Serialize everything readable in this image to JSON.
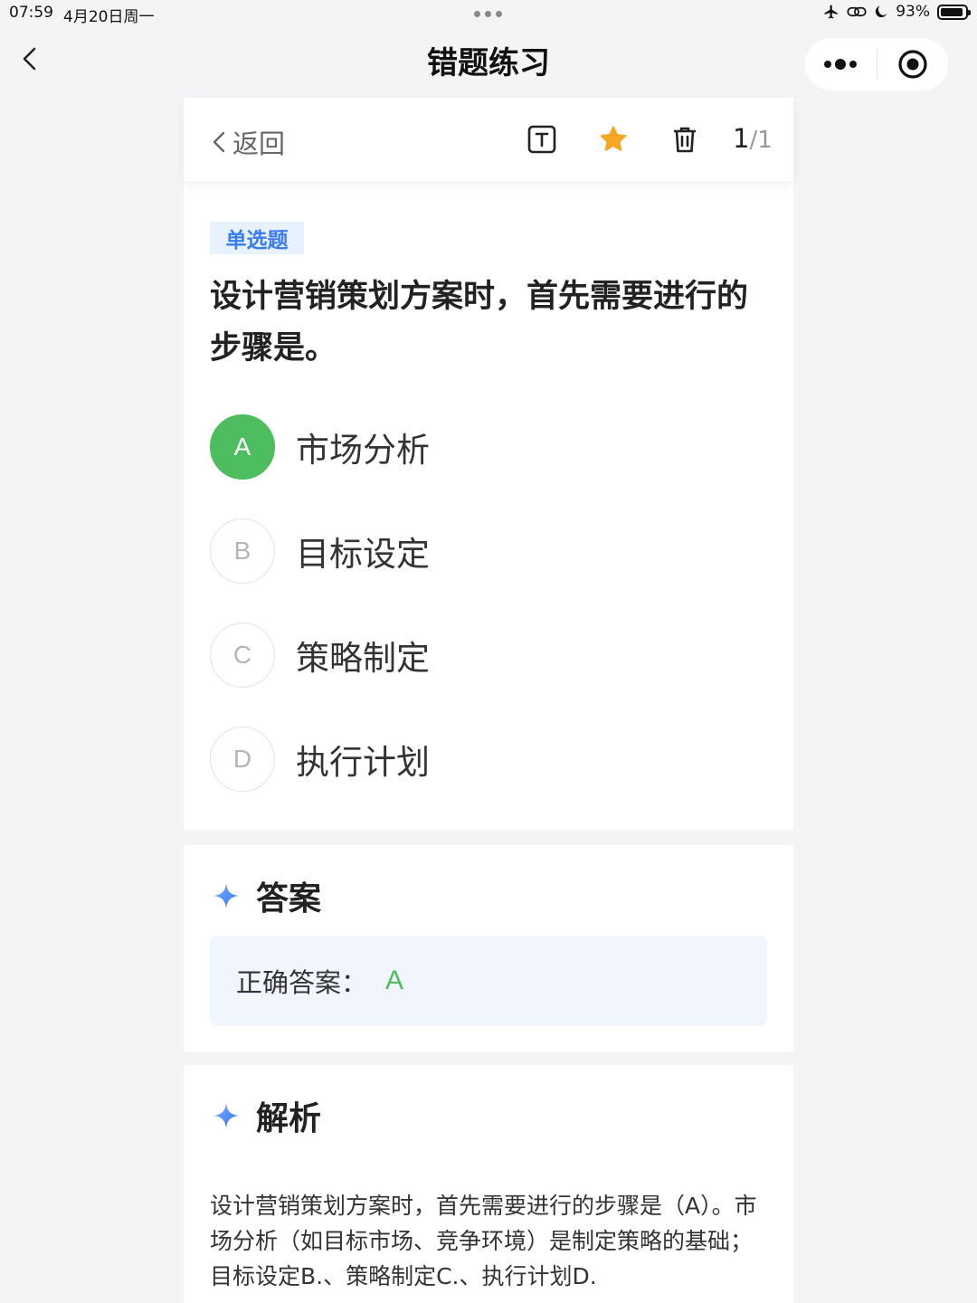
{
  "status_bar": {
    "time": "07:59",
    "date": "4月20日周一",
    "battery": "93%",
    "battery_level": 0.93
  },
  "nav": {
    "title": "错题练习"
  },
  "toolbar": {
    "back_label": "返回",
    "current": "1",
    "separator": "/",
    "total": "1",
    "star_color": "#f5a623"
  },
  "question": {
    "type_tag": "单选题",
    "text": "设计营销策划方案时，首先需要进行的步骤是。",
    "options": [
      {
        "letter": "A",
        "text": "市场分析",
        "state": "correct"
      },
      {
        "letter": "B",
        "text": "目标设定",
        "state": "normal"
      },
      {
        "letter": "C",
        "text": "策略制定",
        "state": "normal"
      },
      {
        "letter": "D",
        "text": "执行计划",
        "state": "normal"
      }
    ]
  },
  "answer": {
    "title": "答案",
    "label": "正确答案：",
    "value": "A"
  },
  "analysis": {
    "title": "解析",
    "text": "设计营销策划方案时，首先需要进行的步骤是（A）。市场分析（如目标市场、竞争环境）是制定策略的基础；目标设定B.、策略制定C.、执行计划D."
  },
  "colors": {
    "accent_blue": "#3a7bf2",
    "correct_green": "#4dbd5f",
    "star": "#f5a623"
  }
}
